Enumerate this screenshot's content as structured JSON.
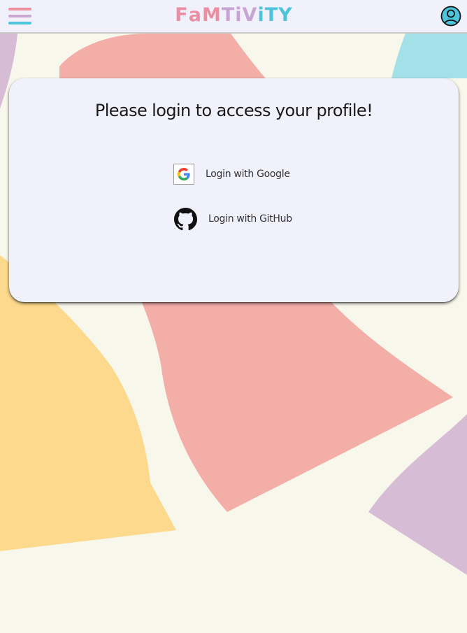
{
  "app": {
    "logo_letters": [
      {
        "char": "F",
        "color": "#ec8ea2"
      },
      {
        "char": "a",
        "color": "#ec8ea2"
      },
      {
        "char": "M",
        "color": "#ec8ea2"
      },
      {
        "char": "T",
        "color": "#c8a4d2"
      },
      {
        "char": "i",
        "color": "#c8a4d2"
      },
      {
        "char": "V",
        "color": "#c8a4d2"
      },
      {
        "char": "i",
        "color": "#4ec4db"
      },
      {
        "char": "T",
        "color": "#4ec4db"
      },
      {
        "char": "Y",
        "color": "#4ec4db"
      }
    ]
  },
  "header": {
    "menu_icon": "hamburger-menu-icon",
    "profile_icon": "user-circle-icon"
  },
  "login": {
    "title": "Please login to access your profile!",
    "google_label": "Login with Google",
    "github_label": "Login with GitHub"
  },
  "colors": {
    "page_bg": "#f8f7ec",
    "card_bg": "#f1f1fc",
    "shape_pink": "#f3aea8",
    "shape_yellow": "#fcd98c",
    "shape_purple": "#d7bcd6",
    "shape_blue": "#a4e0e8"
  }
}
